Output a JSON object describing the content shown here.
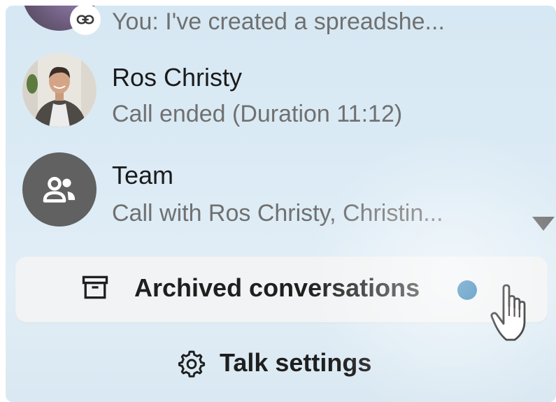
{
  "conversations": [
    {
      "name": "",
      "subtitle": "You: I've created a spreadshe...",
      "avatar": "purple-avatar",
      "badge_icon": "link-icon"
    },
    {
      "name": "Ros Christy",
      "subtitle": "Call ended (Duration 11:12)",
      "avatar": "person-photo"
    },
    {
      "name": "Team",
      "subtitle": "Call with Ros Christy, Christin...",
      "avatar": "group-icon"
    }
  ],
  "archived": {
    "label": "Archived conversations",
    "icon": "archive-icon",
    "dot_color": "#0b6aa8"
  },
  "settings": {
    "label": "Talk settings",
    "icon": "gear-icon"
  },
  "colors": {
    "avatar_gray": "#616161",
    "text_dark": "#1f1f1f",
    "text_muted": "#707070"
  }
}
